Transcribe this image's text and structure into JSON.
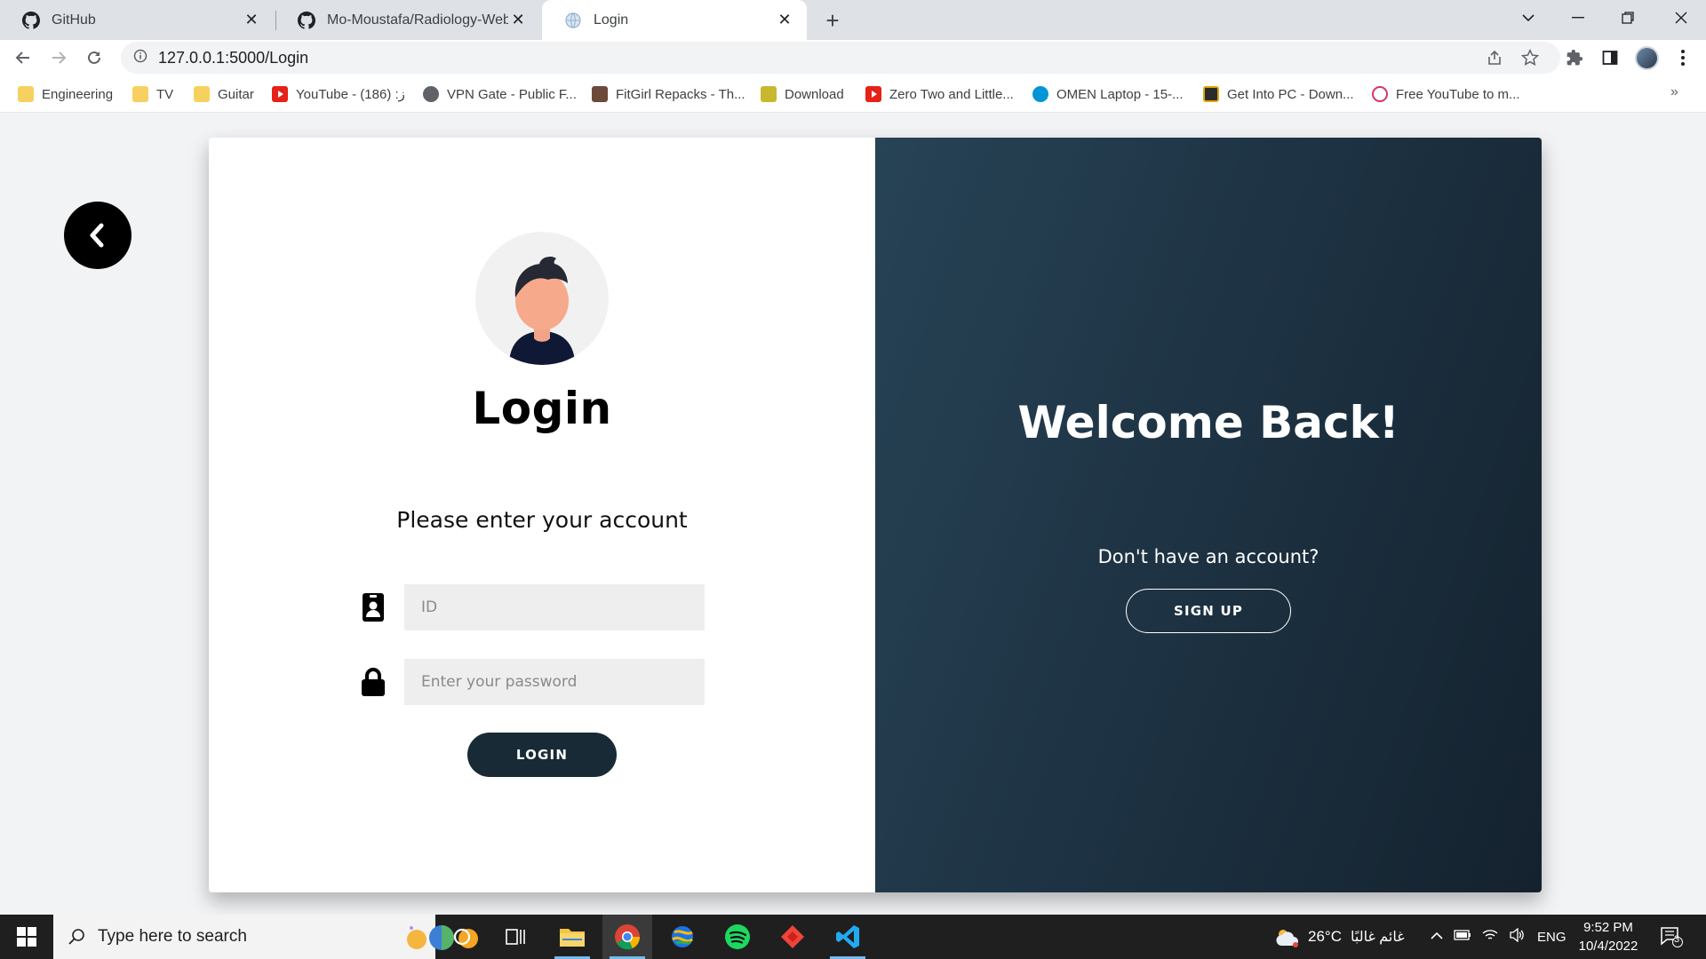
{
  "browser": {
    "tabs": [
      {
        "title": "GitHub",
        "icon": "github-icon"
      },
      {
        "title": "Mo-Moustafa/Radiology-Website",
        "icon": "github-icon"
      },
      {
        "title": "Login",
        "icon": "globe-icon"
      }
    ],
    "address": {
      "url": "127.0.0.1:5000/Login"
    },
    "bookmarks": [
      {
        "label": "Engineering",
        "icon": "folder-icon"
      },
      {
        "label": "TV",
        "icon": "folder-icon"
      },
      {
        "label": "Guitar",
        "icon": "folder-icon"
      },
      {
        "label": "YouTube - ز: (186)",
        "icon": "youtube-icon"
      },
      {
        "label": "VPN Gate - Public F...",
        "icon": "vpn-icon"
      },
      {
        "label": "FitGirl Repacks - Th...",
        "icon": "fitgirl-icon"
      },
      {
        "label": "Download",
        "icon": "download-icon"
      },
      {
        "label": "Zero Two and Little...",
        "icon": "youtube-icon"
      },
      {
        "label": "OMEN Laptop - 15-...",
        "icon": "hp-icon"
      },
      {
        "label": "Get Into PC - Down...",
        "icon": "getintopc-icon"
      },
      {
        "label": "Free YouTube to m...",
        "icon": "converter-icon"
      }
    ]
  },
  "login": {
    "title": "Login",
    "subtitle": "Please enter your account",
    "id_placeholder": "ID",
    "password_placeholder": "Enter your password",
    "login_button": "LOGIN"
  },
  "welcome": {
    "title": "Welcome Back!",
    "prompt": "Don't have an account?",
    "signup_button": "SIGN UP"
  },
  "colors": {
    "dark_panel": "#1c3040",
    "button_dark": "#182a35",
    "input_bg": "#eeeeee"
  },
  "taskbar": {
    "search_placeholder": "Type here to search",
    "weather_temp": "26°C",
    "weather_desc": "غائم غالبًا",
    "language": "ENG",
    "time": "9:52 PM",
    "date": "10/4/2022",
    "notification_count": "3"
  }
}
